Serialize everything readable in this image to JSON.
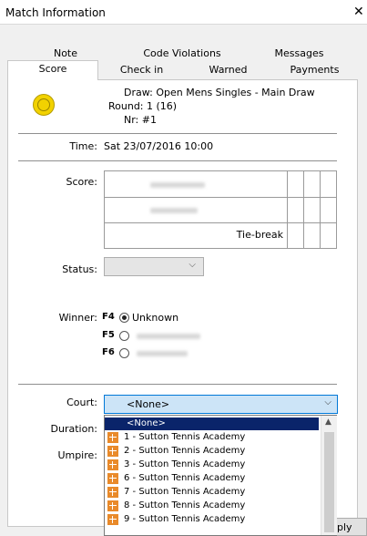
{
  "window": {
    "title": "Match Information",
    "close_glyph": "✕"
  },
  "tabs_row1": [
    "Note",
    "Code Violations",
    "Messages"
  ],
  "tabs_row2": [
    "Score",
    "Check in",
    "Warned",
    "Payments"
  ],
  "match": {
    "draw": "Draw: Open Mens Singles - Main Draw",
    "round": "Round: 1 (16)",
    "nr": "Nr: #1"
  },
  "time": {
    "label": "Time:",
    "value": "Sat 23/07/2016 10:00"
  },
  "score": {
    "label": "Score:",
    "tiebreak": "Tie-break"
  },
  "status": {
    "label": "Status:",
    "value": ""
  },
  "winner": {
    "label": "Winner:",
    "options": [
      {
        "key": "F4",
        "text": "Unknown",
        "selected": true
      },
      {
        "key": "F5",
        "text": "",
        "selected": false
      },
      {
        "key": "F6",
        "text": "",
        "selected": false
      }
    ]
  },
  "court": {
    "label": "Court:",
    "value": "<None>"
  },
  "duration": {
    "label": "Duration:"
  },
  "umpire": {
    "label": "Umpire:"
  },
  "dropdown": {
    "items": [
      "<None>",
      "1 - Sutton Tennis Academy",
      "2 - Sutton Tennis Academy",
      "3 - Sutton Tennis Academy",
      "6 - Sutton Tennis Academy",
      "7 - Sutton Tennis Academy",
      "8 - Sutton Tennis Academy",
      "9 - Sutton Tennis Academy"
    ],
    "selected_index": 0
  },
  "footer": {
    "apply_fragment": "ply"
  },
  "colors": {
    "accent": "#0078d7",
    "selection": "#0a246a",
    "ball": "#f2d200"
  }
}
